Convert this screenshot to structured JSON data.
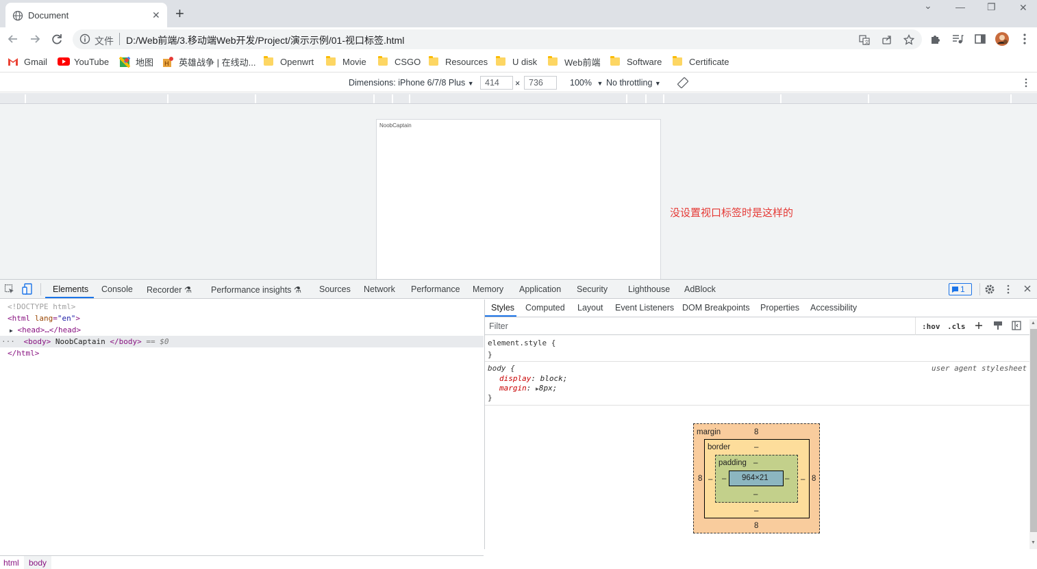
{
  "tab": {
    "title": "Document",
    "close": "✕",
    "new_tab": "+"
  },
  "window": {
    "minimize": "—",
    "restore": "❐",
    "close": "✕",
    "dropdown": "⌄"
  },
  "omnibox": {
    "file_label": "文件",
    "url": "D:/Web前端/3.移动端Web开发/Project/演示示例/01-视口标签.html"
  },
  "bookmarks": [
    {
      "label": "Gmail",
      "icon": "gmail-icon"
    },
    {
      "label": "YouTube",
      "icon": "youtube-icon"
    },
    {
      "label": "地图",
      "icon": "maps-icon"
    },
    {
      "label": "英雄战争 | 在线动...",
      "icon": "game-icon"
    },
    {
      "label": "Openwrt",
      "icon": "folder-icon"
    },
    {
      "label": "Movie",
      "icon": "folder-icon"
    },
    {
      "label": "CSGO",
      "icon": "folder-icon"
    },
    {
      "label": "Resources",
      "icon": "folder-icon"
    },
    {
      "label": "U disk",
      "icon": "folder-icon"
    },
    {
      "label": "Web前端",
      "icon": "folder-icon"
    },
    {
      "label": "Software",
      "icon": "folder-icon"
    },
    {
      "label": "Certificate",
      "icon": "folder-icon"
    }
  ],
  "device_toolbar": {
    "dimensions": "Dimensions: iPhone 6/7/8 Plus",
    "width": "414",
    "times": "×",
    "height": "736",
    "zoom": "100%",
    "throttling": "No throttling"
  },
  "page": {
    "body_text": "NoobCaptain"
  },
  "annotation": "没设置视口标签时是这样的",
  "devtools": {
    "tabs": [
      "Elements",
      "Console",
      "Recorder",
      "Performance insights",
      "Sources",
      "Network",
      "Performance",
      "Memory",
      "Application",
      "Security",
      "Lighthouse",
      "AdBlock"
    ],
    "issues_count": "1",
    "dom": {
      "doctype": "<!DOCTYPE html>",
      "html_open": "<html",
      "lang_attr": "lang",
      "lang_val": "\"en\"",
      "head": "<head>…</head>",
      "body_open": "<body>",
      "body_text": "NoobCaptain",
      "body_close": "</body>",
      "selected_marker": "== $0",
      "html_close": "</html>"
    },
    "breadcrumb": [
      "html",
      "body"
    ],
    "styles_tabs": [
      "Styles",
      "Computed",
      "Layout",
      "Event Listeners",
      "DOM Breakpoints",
      "Properties",
      "Accessibility"
    ],
    "filter_placeholder": "Filter",
    "hov": ":hov",
    "cls": ".cls",
    "element_style": "element.style {",
    "close_brace": "}",
    "body_selector": "body {",
    "ua_source": "user agent stylesheet",
    "display_prop": "display",
    "display_val": "block;",
    "margin_prop": "margin",
    "margin_val": "8px;",
    "box_model": {
      "margin_label": "margin",
      "border_label": "border",
      "padding_label": "padding",
      "margin_top": "8",
      "margin_bottom": "8",
      "margin_left": "8",
      "margin_right": "8",
      "border_top": "–",
      "border_bottom": "–",
      "border_left": "–",
      "border_right": "–",
      "padding_top": "–",
      "padding_bottom": "–",
      "padding_left": "–",
      "padding_right": "–",
      "content": "964×21"
    }
  }
}
